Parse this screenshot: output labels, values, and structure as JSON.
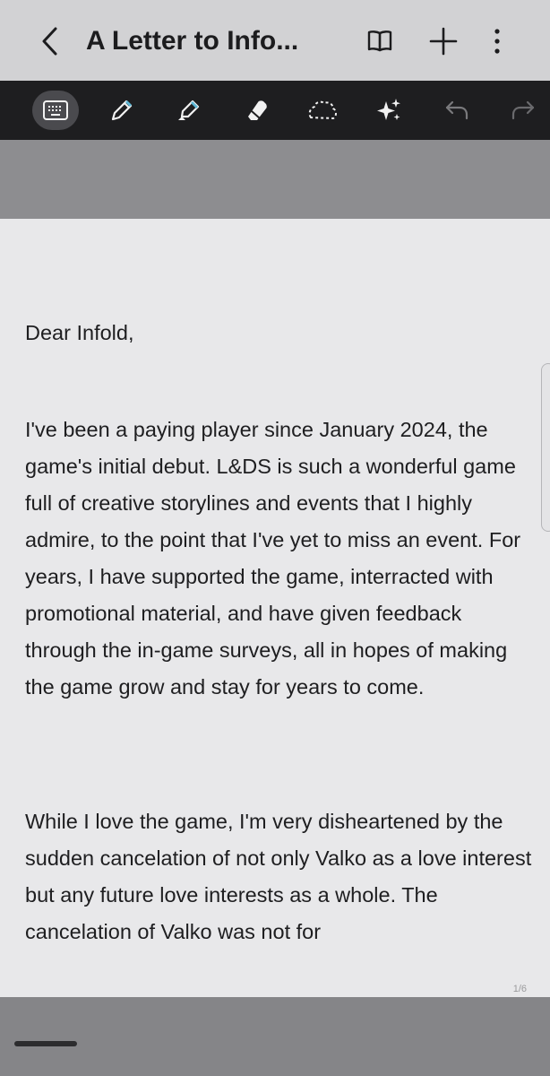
{
  "header": {
    "title": "A Letter to Info...",
    "back_icon": "chevron-left-icon",
    "reader_icon": "book-open-icon",
    "add_icon": "plus-icon",
    "more_icon": "more-vertical-icon"
  },
  "toolbar": {
    "tools": [
      {
        "name": "keyboard-icon",
        "active": true
      },
      {
        "name": "pen-icon",
        "active": false
      },
      {
        "name": "highlighter-icon",
        "active": false
      },
      {
        "name": "eraser-icon",
        "active": false
      },
      {
        "name": "lasso-icon",
        "active": false
      },
      {
        "name": "sparkles-icon",
        "active": false
      },
      {
        "name": "undo-icon",
        "active": false
      },
      {
        "name": "redo-icon",
        "active": false
      }
    ]
  },
  "document": {
    "greeting": "Dear Infold,",
    "paragraph1": "I've been a paying player since January 2024, the game's initial debut. L&DS is such a wonderful game full of creative storylines and events that I highly admire, to the point that I've yet to miss an event. For years, I have supported the game, interracted with promotional material, and have given feedback through the in-game surveys, all in hopes of making the game grow and stay for years to come.",
    "paragraph2": "While I love the game, I'm very disheartened by the sudden cancelation of not only Valko as a love interest but any future love interests as a whole. The cancelation of Valko was not for",
    "page_indicator": "1/6"
  },
  "colors": {
    "topbar": "#d2d2d4",
    "toolbar": "#1e1e20",
    "page": "#e8e8ea",
    "text": "#1e1e20"
  }
}
